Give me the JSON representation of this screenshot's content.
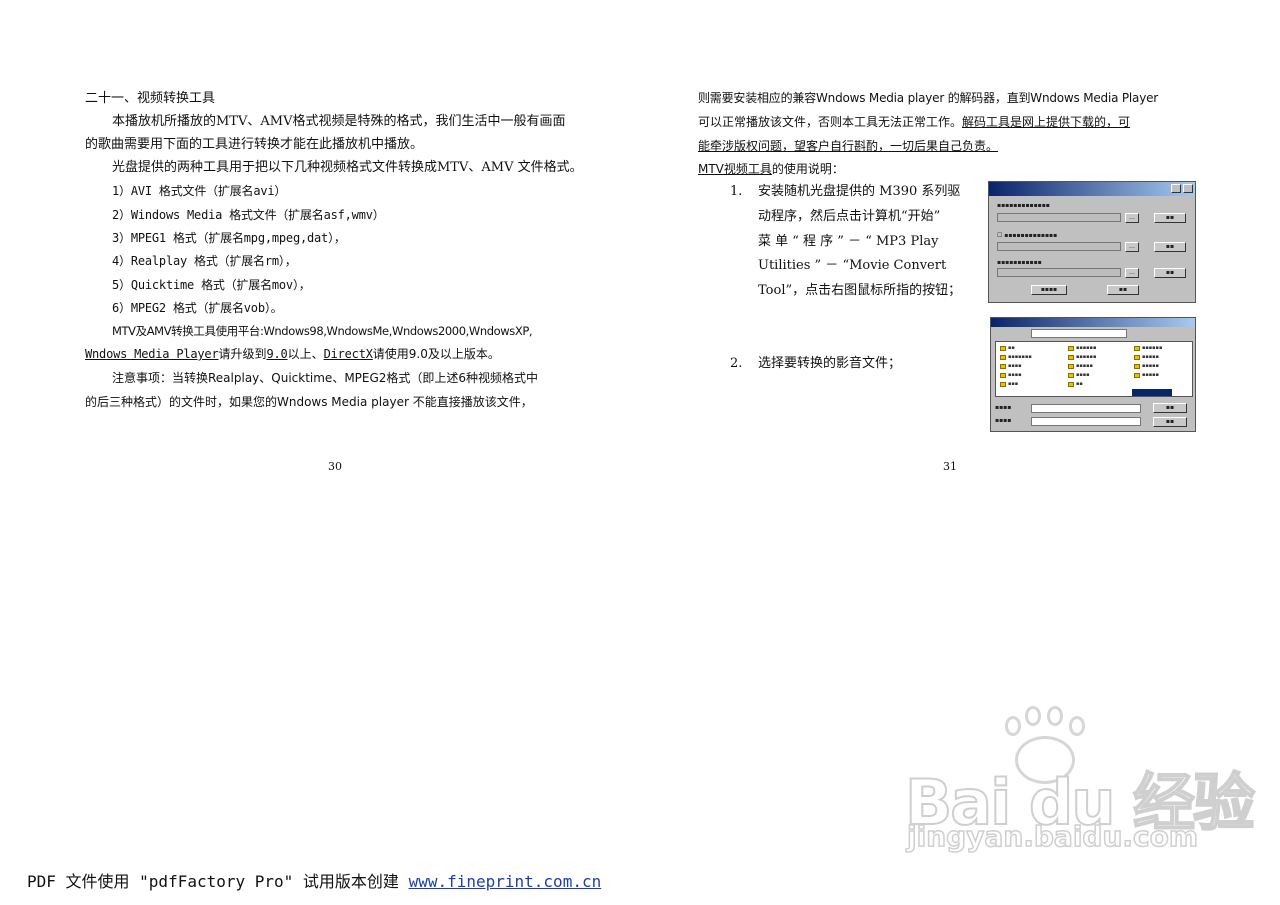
{
  "left_page": {
    "heading": "二十一、视频转换工具",
    "para1_line1": "本播放机所播放的MTV、AMV格式视频是特殊的格式，我们生活中一般有画面",
    "para1_line2": "的歌曲需要用下面的工具进行转换才能在此播放机中播放。",
    "para2": "光盘提供的两种工具用于把以下几种视频格式文件转换成MTV、AMV 文件格式。",
    "formats": [
      "1）AVI 格式文件（扩展名avi）",
      "2）Windows Media 格式文件（扩展名asf,wmv）",
      "3）MPEG1 格式（扩展名mpg,mpeg,dat），",
      "4）Realplay 格式（扩展名rm），",
      "5）Quicktime 格式（扩展名mov），",
      "6）MPEG2 格式（扩展名vob）。"
    ],
    "platform_line": "MTV及AMV转换工具使用平台:Wndows98,WndowsMe,Wndows2000,WndowsXP,",
    "upgrade_part1": "Wndows Media Player",
    "upgrade_part2": "请升级到",
    "upgrade_part3": "9.0",
    "upgrade_part4": "以上、",
    "upgrade_part5": "DirectX",
    "upgrade_part6": "请使用9.0及以上版本。",
    "note_line1": "注意事项：当转换Realplay、Quicktime、MPEG2格式（即上述6种视频格式中",
    "note_line2": "的后三种格式）的文件时，如果您的Wndows Media player 不能直接播放该文件，",
    "page_number": "30"
  },
  "right_page": {
    "line1": "则需要安装相应的兼容Wndows Media player 的解码器，直到Wndows Media Player",
    "line2_a": "可以正常播放该文件，否则本工具无法正常工作。",
    "line2_b": "解码工具是网上提供下载的，可",
    "line3": "能牵涉版权问题，望客户自行斟酌，一切后果自己负责。",
    "tool_title": "MTV视频工具",
    "tool_title_suffix": "的使用说明：",
    "step1_num": "1.",
    "step1_lines": [
      "安装随机光盘提供的 M390 系列驱",
      "动程序，然后点击计算机“开始”",
      "菜 单 “ 程 序 ” － “ MP3  Play",
      "Utilities ” － “Movie  Convert",
      "Tool”，点击右图鼠标所指的按钮；"
    ],
    "step2_num": "2.",
    "step2_text": "选择要转换的影音文件；",
    "page_number": "31"
  },
  "footer": {
    "text": "PDF 文件使用 \"pdfFactory Pro\" 试用版本创建 ",
    "link": "www.fineprint.com.cn"
  },
  "watermark": {
    "brand": "Bai du 经验",
    "url": "jingyan.baidu.com"
  }
}
